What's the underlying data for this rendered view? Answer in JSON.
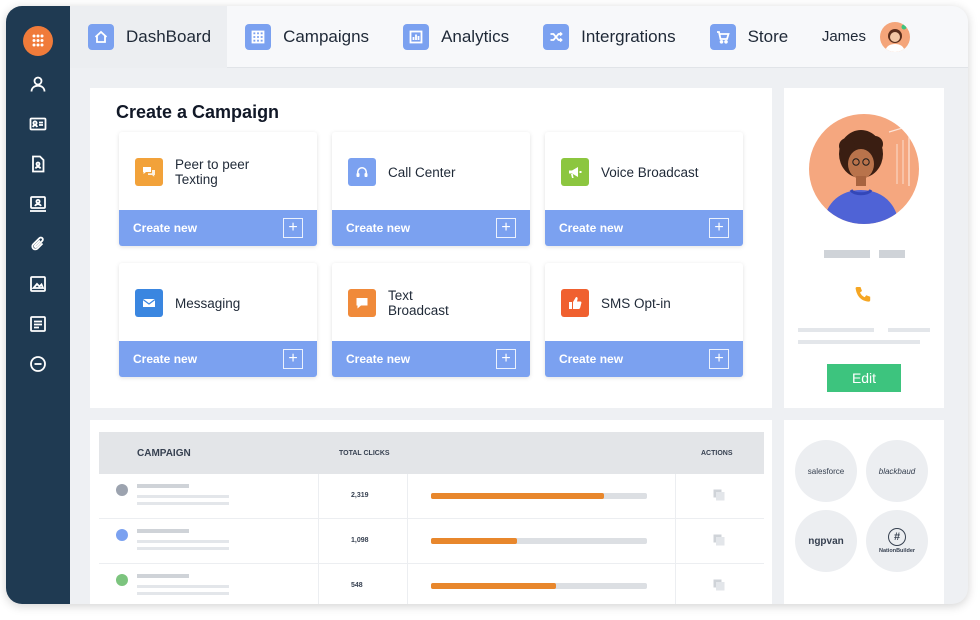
{
  "colors": {
    "sidebar": "#1f3a52",
    "accent_blue": "#7ba1f0",
    "orange": "#e8872c",
    "green_button": "#3dc47e",
    "logo": "#f07b3a"
  },
  "sidebar": {
    "icons": [
      "user-icon",
      "contact-card-icon",
      "document-icon",
      "monitor-icon",
      "attachment-icon",
      "image-icon",
      "form-icon",
      "minus-circle-icon"
    ]
  },
  "nav": {
    "tabs": [
      {
        "label": "DashBoard",
        "icon": "home-icon"
      },
      {
        "label": "Campaigns",
        "icon": "grid-icon"
      },
      {
        "label": "Analytics",
        "icon": "bar-chart-icon"
      },
      {
        "label": "Intergrations",
        "icon": "shuffle-icon"
      },
      {
        "label": "Store",
        "icon": "cart-icon"
      }
    ],
    "user_name": "James"
  },
  "create": {
    "title": "Create a Campaign",
    "cards": [
      {
        "label": "Peer to peer\nTexting",
        "icon": "chat-bubbles-icon",
        "color": "#f2a23a",
        "action": "Create new"
      },
      {
        "label": "Call Center",
        "icon": "headset-icon",
        "color": "#7ba1f0",
        "action": "Create new"
      },
      {
        "label": "Voice Broadcast",
        "icon": "megaphone-icon",
        "color": "#8cc63f",
        "action": "Create new"
      },
      {
        "label": "Messaging",
        "icon": "envelope-icon",
        "color": "#3a86e0",
        "action": "Create new"
      },
      {
        "label": "Text\nBroadcast",
        "icon": "speech-bubble-icon",
        "color": "#f08a3a",
        "action": "Create new"
      },
      {
        "label": "SMS Opt-in",
        "icon": "thumbs-up-icon",
        "color": "#f0602f",
        "action": "Create new"
      }
    ]
  },
  "profile": {
    "edit_label": "Edit"
  },
  "table": {
    "headers": {
      "campaign": "CAMPAIGN",
      "clicks": "TOTAL CLICKS",
      "actions": "ACTIONS"
    },
    "rows": [
      {
        "dot_color": "#9ca3af",
        "clicks": "2,319",
        "progress": 0.8
      },
      {
        "dot_color": "#7ba1f0",
        "clicks": "1,098",
        "progress": 0.4
      },
      {
        "dot_color": "#7cc47e",
        "clicks": "548",
        "progress": 0.58
      }
    ]
  },
  "partners": [
    {
      "name": "salesforce"
    },
    {
      "name": "blackbaud"
    },
    {
      "name": "ngpvan"
    },
    {
      "name": "NationBuilder"
    }
  ]
}
